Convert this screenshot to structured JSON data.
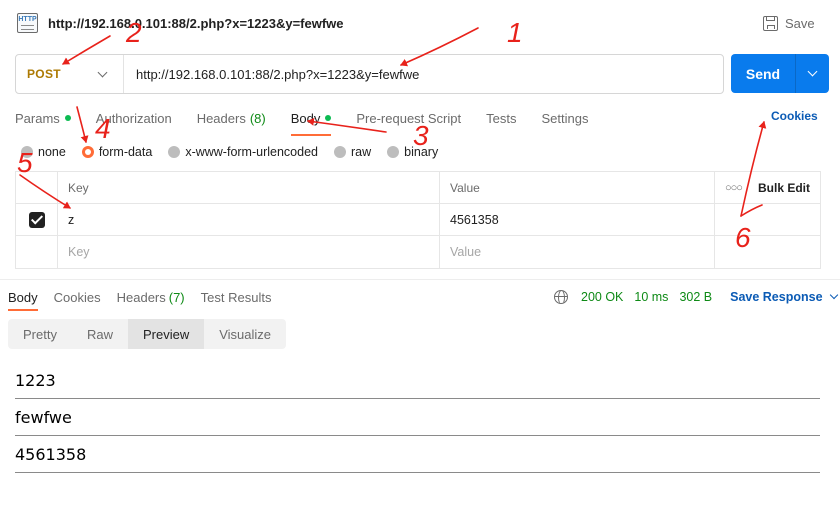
{
  "titlebar": {
    "icon": "http-icon",
    "icon_text": "HTTP",
    "title": "http://192.168.0.101:88/2.php?x=1223&y=fewfwe",
    "save_label": "Save"
  },
  "request": {
    "method": "POST",
    "url": "http://192.168.0.101:88/2.php?x=1223&y=fewfwe",
    "send_label": "Send"
  },
  "request_tabs": [
    {
      "label": "Params",
      "dot": true,
      "count": ""
    },
    {
      "label": "Authorization",
      "dot": false,
      "count": ""
    },
    {
      "label": "Headers",
      "dot": false,
      "count": "(8)"
    },
    {
      "label": "Body",
      "dot": true,
      "count": "",
      "active": true
    },
    {
      "label": "Pre-request Script",
      "dot": false,
      "count": ""
    },
    {
      "label": "Tests",
      "dot": false,
      "count": ""
    },
    {
      "label": "Settings",
      "dot": false,
      "count": ""
    }
  ],
  "cookies_label": "Cookies",
  "body_types": [
    {
      "label": "none",
      "selected": false
    },
    {
      "label": "form-data",
      "selected": true
    },
    {
      "label": "x-www-form-urlencoded",
      "selected": false
    },
    {
      "label": "raw",
      "selected": false
    },
    {
      "label": "binary",
      "selected": false
    }
  ],
  "form_table": {
    "headers": {
      "key": "Key",
      "value": "Value",
      "bulk_edit": "Bulk Edit"
    },
    "rows": [
      {
        "checked": true,
        "key": "z",
        "value": "4561358"
      }
    ],
    "placeholder": {
      "key": "Key",
      "value": "Value"
    }
  },
  "response_tabs": [
    {
      "label": "Body",
      "count": "",
      "active": true
    },
    {
      "label": "Cookies",
      "count": ""
    },
    {
      "label": "Headers",
      "count": "(7)"
    },
    {
      "label": "Test Results",
      "count": ""
    }
  ],
  "response_meta": {
    "status": "200 OK",
    "time": "10 ms",
    "size": "302 B",
    "save_response_label": "Save Response"
  },
  "view_tabs": [
    {
      "label": "Pretty",
      "active": false
    },
    {
      "label": "Raw",
      "active": false
    },
    {
      "label": "Preview",
      "active": true
    },
    {
      "label": "Visualize",
      "active": false
    }
  ],
  "preview_lines": [
    "1223",
    "fewfwe",
    "4561358"
  ],
  "colors": {
    "accent": "#ff6c37",
    "send_button": "#097bed",
    "method_post": "#ad7a03",
    "status_green": "#0e8a16",
    "link_blue": "#0b5bb5",
    "annotation_red": "#e8221b"
  },
  "annotations": [
    "1",
    "2",
    "3",
    "4",
    "5",
    "6"
  ]
}
